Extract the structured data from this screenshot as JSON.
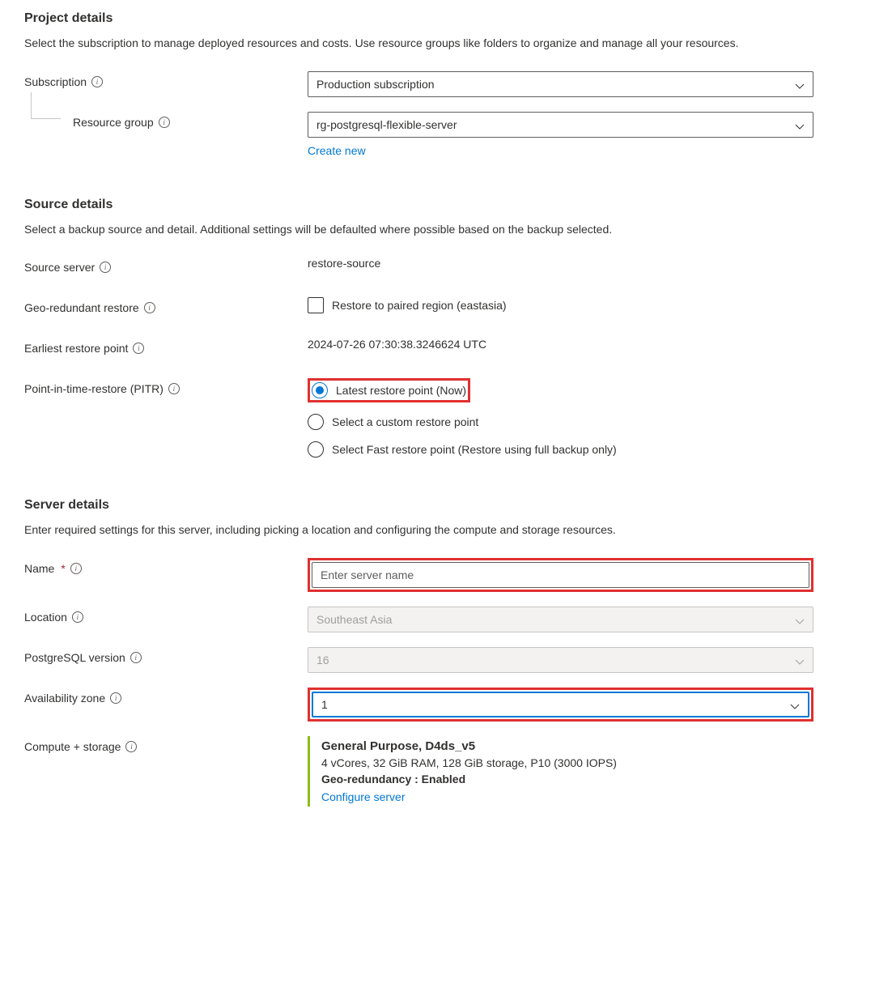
{
  "project": {
    "title": "Project details",
    "desc": "Select the subscription to manage deployed resources and costs. Use resource groups like folders to organize and manage all your resources.",
    "subscription_label": "Subscription",
    "subscription_value": "Production subscription",
    "resource_group_label": "Resource group",
    "resource_group_value": "rg-postgresql-flexible-server",
    "create_new": "Create new"
  },
  "source": {
    "title": "Source details",
    "desc": "Select a backup source and detail. Additional settings will be defaulted where possible based on the backup selected.",
    "source_server_label": "Source server",
    "source_server_value": "restore-source",
    "geo_label": "Geo-redundant restore",
    "geo_checkbox_label": "Restore to paired region (eastasia)",
    "earliest_label": "Earliest restore point",
    "earliest_value": "2024-07-26 07:30:38.3246624 UTC",
    "pitr_label": "Point-in-time-restore (PITR)",
    "pitr_options": {
      "opt1": "Latest restore point (Now)",
      "opt2": "Select a custom restore point",
      "opt3": "Select Fast restore point (Restore using full backup only)"
    }
  },
  "server": {
    "title": "Server details",
    "desc": "Enter required settings for this server, including picking a location and configuring the compute and storage resources.",
    "name_label": "Name",
    "name_placeholder": "Enter server name",
    "location_label": "Location",
    "location_value": "Southeast Asia",
    "pg_version_label": "PostgreSQL version",
    "pg_version_value": "16",
    "az_label": "Availability zone",
    "az_value": "1",
    "compute_label": "Compute + storage",
    "compute_tier": "General Purpose, D4ds_v5",
    "compute_spec": "4 vCores, 32 GiB RAM, 128 GiB storage, P10 (3000 IOPS)",
    "compute_geo": "Geo-redundancy : Enabled",
    "configure_link": "Configure server"
  }
}
